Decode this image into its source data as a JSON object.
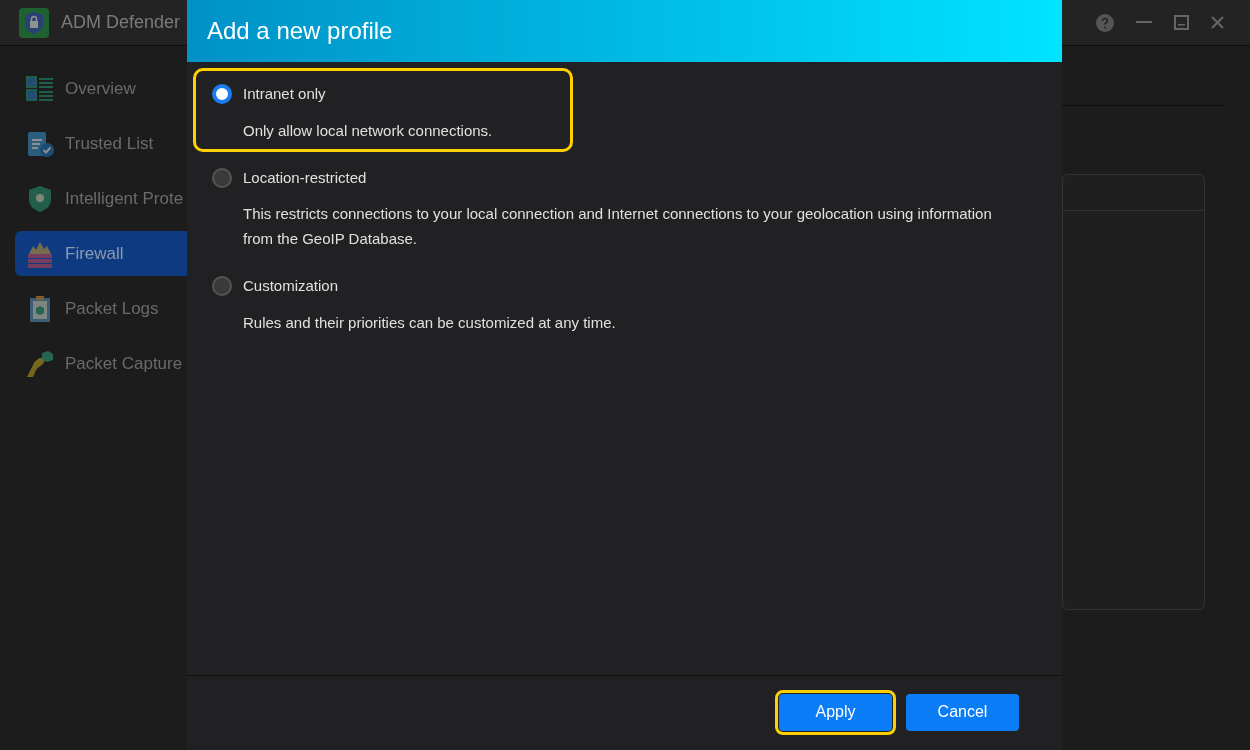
{
  "window": {
    "title": "ADM Defender"
  },
  "sidebar": {
    "items": [
      {
        "label": "Overview",
        "selected": false
      },
      {
        "label": "Trusted List",
        "selected": false
      },
      {
        "label": "Intelligent Prote",
        "selected": false
      },
      {
        "label": "Firewall",
        "selected": true
      },
      {
        "label": "Packet Logs",
        "selected": false
      },
      {
        "label": "Packet Capture",
        "selected": false
      }
    ]
  },
  "dialog": {
    "title": "Add a new profile",
    "options": [
      {
        "label": "Intranet only",
        "description": "Only allow local network connections.",
        "selected": true,
        "highlighted": true
      },
      {
        "label": "Location-restricted",
        "description": "This restricts connections to your local connection and Internet connections to your geolocation using information from the GeoIP Database.",
        "selected": false,
        "highlighted": false
      },
      {
        "label": "Customization",
        "description": "Rules and their priorities can be customized at any time.",
        "selected": false,
        "highlighted": false
      }
    ],
    "buttons": [
      {
        "label": "Apply",
        "highlighted": true
      },
      {
        "label": "Cancel",
        "highlighted": false
      }
    ]
  }
}
